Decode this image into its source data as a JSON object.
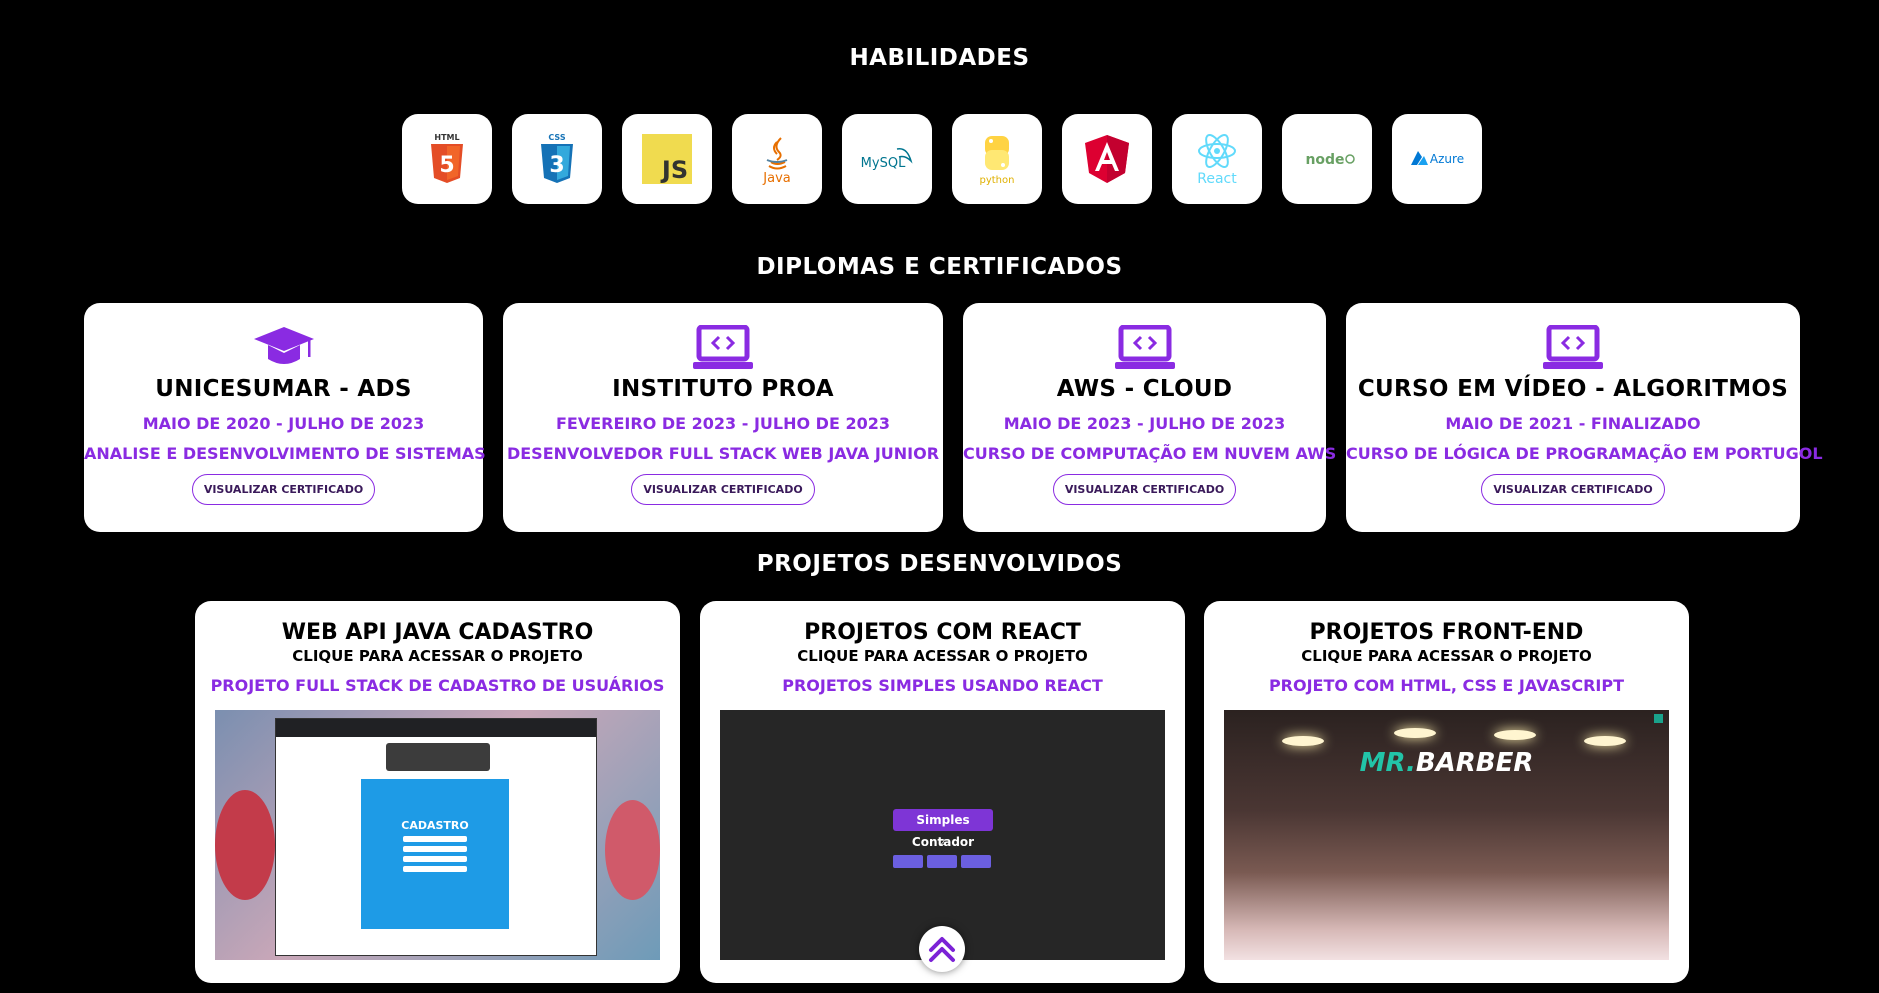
{
  "skills_section": {
    "title": "HABILIDADES",
    "items": [
      {
        "name": "HTML",
        "icon": "html5-icon"
      },
      {
        "name": "CSS",
        "icon": "css3-icon"
      },
      {
        "name": "JS",
        "icon": "javascript-icon"
      },
      {
        "name": "Java",
        "icon": "java-icon"
      },
      {
        "name": "MySQL",
        "icon": "mysql-icon"
      },
      {
        "name": "python",
        "icon": "python-icon"
      },
      {
        "name": "Angular",
        "icon": "angular-icon"
      },
      {
        "name": "React",
        "icon": "react-icon"
      },
      {
        "name": "node",
        "icon": "nodejs-icon"
      },
      {
        "name": "Azure",
        "icon": "azure-icon"
      }
    ]
  },
  "certificates_section": {
    "title": "DIPLOMAS E CERTIFICADOS",
    "items": [
      {
        "name": "UNICESUMAR - ADS",
        "date": "MAIO DE 2020 - JULHO DE 2023",
        "course": "ANALISE E DESENVOLVIMENTO DE SISTEMAS",
        "button": "VISUALIZAR CERTIFICADO",
        "icon": "graduation-cap-icon"
      },
      {
        "name": "INSTITUTO PROA",
        "date": "FEVEREIRO DE 2023 - JULHO DE 2023",
        "course": "DESENVOLVEDOR FULL STACK WEB JAVA JUNIOR",
        "button": "VISUALIZAR CERTIFICADO",
        "icon": "laptop-code-icon"
      },
      {
        "name": "AWS - CLOUD",
        "date": "MAIO DE 2023 - JULHO DE 2023",
        "course": "CURSO DE COMPUTAÇÃO EM NUVEM AWS",
        "button": "VISUALIZAR CERTIFICADO",
        "icon": "laptop-code-icon"
      },
      {
        "name": "CURSO EM VÍDEO - ALGORITMOS",
        "date": "MAIO DE 2021 - FINALIZADO",
        "course": "CURSO DE LÓGICA DE PROGRAMAÇÃO EM PORTUGOL",
        "button": "VISUALIZAR CERTIFICADO",
        "icon": "laptop-code-icon"
      }
    ]
  },
  "projects_section": {
    "title": "PROJETOS DESENVOLVIDOS",
    "items": [
      {
        "title": "WEB API JAVA CADASTRO",
        "hint": "CLIQUE PARA ACESSAR O PROJETO",
        "desc": "PROJETO FULL STACK DE CADASTRO DE USUÁRIOS",
        "preview_text": "CADASTRO"
      },
      {
        "title": "PROJETOS COM REACT",
        "hint": "CLIQUE PARA ACESSAR O PROJETO",
        "desc": "PROJETOS SIMPLES USANDO REACT",
        "preview_text": "Simples Contador",
        "preview_count": "2"
      },
      {
        "title": "PROJETOS FRONT-END",
        "hint": "CLIQUE PARA ACESSAR O PROJETO",
        "desc": "PROJETO COM HTML, CSS E JAVASCRIPT",
        "preview_logo_a": "MR.",
        "preview_logo_b": "BARBER"
      }
    ]
  },
  "back_to_top": {
    "icon": "double-chevron-up-icon"
  },
  "colors": {
    "accent": "#8a2be2",
    "background": "#000000",
    "card": "#ffffff"
  }
}
